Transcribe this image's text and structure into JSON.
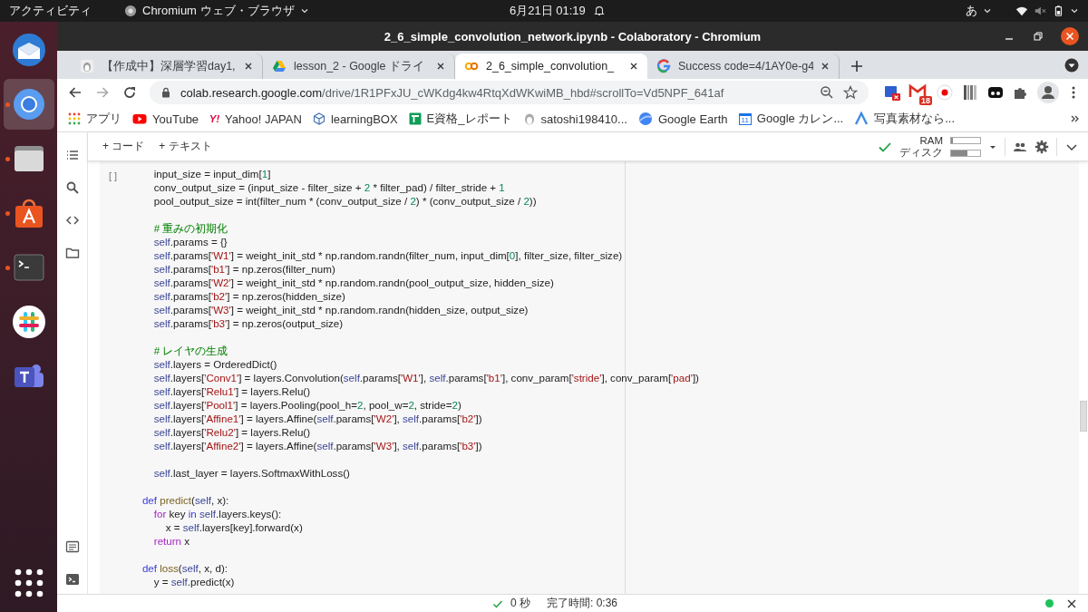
{
  "top_bar": {
    "activities": "アクティビティ",
    "app_menu": "Chromium ウェブ・ブラウザ",
    "clock": "6月21日 01:19",
    "input_method": "あ"
  },
  "dock": [
    {
      "kind": "thunderbird",
      "running": false,
      "selected": false
    },
    {
      "kind": "chromium",
      "running": true,
      "selected": true
    },
    {
      "kind": "files",
      "running": true,
      "selected": false
    },
    {
      "kind": "software",
      "running": true,
      "selected": false
    },
    {
      "kind": "terminal",
      "running": true,
      "selected": false
    },
    {
      "kind": "slack",
      "running": false,
      "selected": false
    },
    {
      "kind": "teams",
      "running": false,
      "selected": false
    },
    {
      "kind": "apps",
      "running": false,
      "selected": false
    }
  ],
  "window": {
    "title": "2_6_simple_convolution_network.ipynb - Colaboratory - Chromium"
  },
  "tabs": [
    {
      "kind": "figure",
      "label": "【作成中】深層学習day1,",
      "selected": false
    },
    {
      "kind": "drive",
      "label": "lesson_2 - Google ドライ",
      "selected": false
    },
    {
      "kind": "colab",
      "label": "2_6_simple_convolution_",
      "selected": true
    },
    {
      "kind": "google",
      "label": "Success code=4/1AY0e-g4",
      "selected": false
    }
  ],
  "address": {
    "host": "colab.research.google.com",
    "path": "/drive/1R1PFxJU_cWKdg4kw4RtqXdWKwiMB_hbd#scrollTo=Vd5NPF_641af"
  },
  "extensions": [
    {
      "kind": "square-x"
    },
    {
      "kind": "mail",
      "badge": "18"
    },
    {
      "kind": "record"
    },
    {
      "kind": "stripes"
    },
    {
      "kind": "mask"
    },
    {
      "kind": "puzzle"
    },
    {
      "kind": "avatar"
    }
  ],
  "bookmarks": [
    {
      "kind": "grid",
      "label": "アプリ"
    },
    {
      "kind": "play",
      "label": "YouTube"
    },
    {
      "kind": "yahoo",
      "label": "Yahoo! JAPAN",
      "mark": "Y!"
    },
    {
      "kind": "cube",
      "label": "learningBOX"
    },
    {
      "kind": "sheet",
      "label": "E資格_レポート"
    },
    {
      "kind": "figure",
      "label": "satoshi198410..."
    },
    {
      "kind": "globe",
      "label": "Google Earth"
    },
    {
      "kind": "calendar",
      "label": "Google カレン...",
      "mark": "11"
    },
    {
      "kind": "peak",
      "label": "写真素材なら..."
    }
  ],
  "toolbar": {
    "add_code": "+ コード",
    "add_text": "+ テキスト"
  },
  "resources": [
    {
      "label": "RAM",
      "level": 0.05
    },
    {
      "label": "ディスク",
      "level": 0.55
    }
  ],
  "cell": {
    "run_label": "[ ]",
    "lines": [
      {
        "tokens": [
          {
            "kind": "plain",
            "text": "        input_size = input_dim["
          },
          {
            "kind": "num",
            "text": "1"
          },
          {
            "kind": "plain",
            "text": "]"
          }
        ]
      },
      {
        "tokens": [
          {
            "kind": "plain",
            "text": "        conv_output_size = (input_size - filter_size + "
          },
          {
            "kind": "num",
            "text": "2"
          },
          {
            "kind": "plain",
            "text": " * filter_pad) / filter_stride + "
          },
          {
            "kind": "num",
            "text": "1"
          }
        ]
      },
      {
        "tokens": [
          {
            "kind": "plain",
            "text": "        pool_output_size = int(filter_num * (conv_output_size / "
          },
          {
            "kind": "num",
            "text": "2"
          },
          {
            "kind": "plain",
            "text": ") * (conv_output_size / "
          },
          {
            "kind": "num",
            "text": "2"
          },
          {
            "kind": "plain",
            "text": "))"
          }
        ]
      },
      {
        "kind": "blank"
      },
      {
        "tokens": [
          {
            "kind": "comment",
            "text": "        # 重みの初期化"
          }
        ]
      },
      {
        "tokens": [
          {
            "kind": "self",
            "text": "        self"
          },
          {
            "kind": "plain",
            "text": ".params = {}"
          }
        ]
      },
      {
        "tokens": [
          {
            "kind": "self",
            "text": "        self"
          },
          {
            "kind": "plain",
            "text": ".params["
          },
          {
            "kind": "str",
            "text": "'W1'"
          },
          {
            "kind": "plain",
            "text": "] = weight_init_std * np.random.randn(filter_num, input_dim["
          },
          {
            "kind": "num",
            "text": "0"
          },
          {
            "kind": "plain",
            "text": "], filter_size, filter_size)"
          }
        ]
      },
      {
        "tokens": [
          {
            "kind": "self",
            "text": "        self"
          },
          {
            "kind": "plain",
            "text": ".params["
          },
          {
            "kind": "str",
            "text": "'b1'"
          },
          {
            "kind": "plain",
            "text": "] = np.zeros(filter_num)"
          }
        ]
      },
      {
        "tokens": [
          {
            "kind": "self",
            "text": "        self"
          },
          {
            "kind": "plain",
            "text": ".params["
          },
          {
            "kind": "str",
            "text": "'W2'"
          },
          {
            "kind": "plain",
            "text": "] = weight_init_std * np.random.randn(pool_output_size, hidden_size)"
          }
        ]
      },
      {
        "tokens": [
          {
            "kind": "self",
            "text": "        self"
          },
          {
            "kind": "plain",
            "text": ".params["
          },
          {
            "kind": "str",
            "text": "'b2'"
          },
          {
            "kind": "plain",
            "text": "] = np.zeros(hidden_size)"
          }
        ]
      },
      {
        "tokens": [
          {
            "kind": "self",
            "text": "        self"
          },
          {
            "kind": "plain",
            "text": ".params["
          },
          {
            "kind": "str",
            "text": "'W3'"
          },
          {
            "kind": "plain",
            "text": "] = weight_init_std * np.random.randn(hidden_size, output_size)"
          }
        ]
      },
      {
        "tokens": [
          {
            "kind": "self",
            "text": "        self"
          },
          {
            "kind": "plain",
            "text": ".params["
          },
          {
            "kind": "str",
            "text": "'b3'"
          },
          {
            "kind": "plain",
            "text": "] = np.zeros(output_size)"
          }
        ]
      },
      {
        "kind": "blank"
      },
      {
        "tokens": [
          {
            "kind": "comment",
            "text": "        # レイヤの生成"
          }
        ]
      },
      {
        "tokens": [
          {
            "kind": "self",
            "text": "        self"
          },
          {
            "kind": "plain",
            "text": ".layers = OrderedDict()"
          }
        ]
      },
      {
        "tokens": [
          {
            "kind": "self",
            "text": "        self"
          },
          {
            "kind": "plain",
            "text": ".layers["
          },
          {
            "kind": "str",
            "text": "'Conv1'"
          },
          {
            "kind": "plain",
            "text": "] = layers.Convolution("
          },
          {
            "kind": "self",
            "text": "self"
          },
          {
            "kind": "plain",
            "text": ".params["
          },
          {
            "kind": "str",
            "text": "'W1'"
          },
          {
            "kind": "plain",
            "text": "], "
          },
          {
            "kind": "self",
            "text": "self"
          },
          {
            "kind": "plain",
            "text": ".params["
          },
          {
            "kind": "str",
            "text": "'b1'"
          },
          {
            "kind": "plain",
            "text": "], conv_param["
          },
          {
            "kind": "str",
            "text": "'stride'"
          },
          {
            "kind": "plain",
            "text": "], conv_param["
          },
          {
            "kind": "str",
            "text": "'pad'"
          },
          {
            "kind": "plain",
            "text": "])"
          }
        ]
      },
      {
        "tokens": [
          {
            "kind": "self",
            "text": "        self"
          },
          {
            "kind": "plain",
            "text": ".layers["
          },
          {
            "kind": "str",
            "text": "'Relu1'"
          },
          {
            "kind": "plain",
            "text": "] = layers.Relu()"
          }
        ]
      },
      {
        "tokens": [
          {
            "kind": "self",
            "text": "        self"
          },
          {
            "kind": "plain",
            "text": ".layers["
          },
          {
            "kind": "str",
            "text": "'Pool1'"
          },
          {
            "kind": "plain",
            "text": "] = layers.Pooling(pool_h="
          },
          {
            "kind": "num",
            "text": "2"
          },
          {
            "kind": "plain",
            "text": ", pool_w="
          },
          {
            "kind": "num",
            "text": "2"
          },
          {
            "kind": "plain",
            "text": ", stride="
          },
          {
            "kind": "num",
            "text": "2"
          },
          {
            "kind": "plain",
            "text": ")"
          }
        ]
      },
      {
        "tokens": [
          {
            "kind": "self",
            "text": "        self"
          },
          {
            "kind": "plain",
            "text": ".layers["
          },
          {
            "kind": "str",
            "text": "'Affine1'"
          },
          {
            "kind": "plain",
            "text": "] = layers.Affine("
          },
          {
            "kind": "self",
            "text": "self"
          },
          {
            "kind": "plain",
            "text": ".params["
          },
          {
            "kind": "str",
            "text": "'W2'"
          },
          {
            "kind": "plain",
            "text": "], "
          },
          {
            "kind": "self",
            "text": "self"
          },
          {
            "kind": "plain",
            "text": ".params["
          },
          {
            "kind": "str",
            "text": "'b2'"
          },
          {
            "kind": "plain",
            "text": "])"
          }
        ]
      },
      {
        "tokens": [
          {
            "kind": "self",
            "text": "        self"
          },
          {
            "kind": "plain",
            "text": ".layers["
          },
          {
            "kind": "str",
            "text": "'Relu2'"
          },
          {
            "kind": "plain",
            "text": "] = layers.Relu()"
          }
        ]
      },
      {
        "tokens": [
          {
            "kind": "self",
            "text": "        self"
          },
          {
            "kind": "plain",
            "text": ".layers["
          },
          {
            "kind": "str",
            "text": "'Affine2'"
          },
          {
            "kind": "plain",
            "text": "] = layers.Affine("
          },
          {
            "kind": "self",
            "text": "self"
          },
          {
            "kind": "plain",
            "text": ".params["
          },
          {
            "kind": "str",
            "text": "'W3'"
          },
          {
            "kind": "plain",
            "text": "], "
          },
          {
            "kind": "self",
            "text": "self"
          },
          {
            "kind": "plain",
            "text": ".params["
          },
          {
            "kind": "str",
            "text": "'b3'"
          },
          {
            "kind": "plain",
            "text": "])"
          }
        ]
      },
      {
        "kind": "blank"
      },
      {
        "tokens": [
          {
            "kind": "self",
            "text": "        self"
          },
          {
            "kind": "plain",
            "text": ".last_layer = layers.SoftmaxWithLoss()"
          }
        ]
      },
      {
        "kind": "blank"
      },
      {
        "tokens": [
          {
            "kind": "keyword",
            "text": "    def "
          },
          {
            "kind": "func",
            "text": "predict"
          },
          {
            "kind": "plain",
            "text": "("
          },
          {
            "kind": "self",
            "text": "self"
          },
          {
            "kind": "plain",
            "text": ", x):"
          }
        ]
      },
      {
        "tokens": [
          {
            "kind": "control",
            "text": "        for"
          },
          {
            "kind": "plain",
            "text": " key "
          },
          {
            "kind": "keyword",
            "text": "in "
          },
          {
            "kind": "self",
            "text": "self"
          },
          {
            "kind": "plain",
            "text": ".layers.keys():"
          }
        ]
      },
      {
        "tokens": [
          {
            "kind": "plain",
            "text": "            x = "
          },
          {
            "kind": "self",
            "text": "self"
          },
          {
            "kind": "plain",
            "text": ".layers[key].forward(x)"
          }
        ]
      },
      {
        "tokens": [
          {
            "kind": "control",
            "text": "        return"
          },
          {
            "kind": "plain",
            "text": " x"
          }
        ]
      },
      {
        "kind": "blank"
      },
      {
        "tokens": [
          {
            "kind": "keyword",
            "text": "    def "
          },
          {
            "kind": "func",
            "text": "loss"
          },
          {
            "kind": "plain",
            "text": "("
          },
          {
            "kind": "self",
            "text": "self"
          },
          {
            "kind": "plain",
            "text": ", x, d):"
          }
        ]
      },
      {
        "tokens": [
          {
            "kind": "plain",
            "text": "        y = "
          },
          {
            "kind": "self",
            "text": "self"
          },
          {
            "kind": "plain",
            "text": ".predict(x)"
          }
        ]
      }
    ]
  },
  "status_bar": {
    "duration": "0 秒",
    "finished": "完了時間: 0:36",
    "connected": true
  }
}
